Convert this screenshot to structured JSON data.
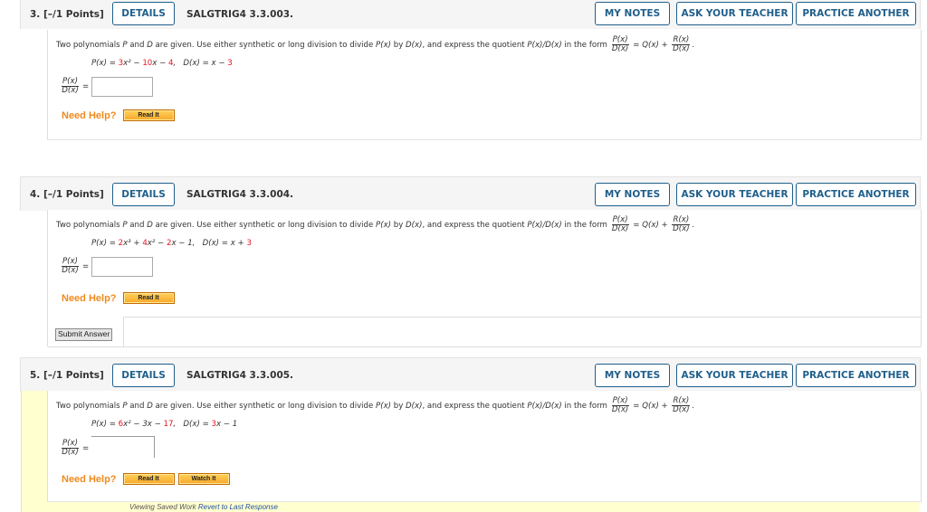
{
  "questions": [
    {
      "number": "3.",
      "points": "[–/1 Points]",
      "details_label": "DETAILS",
      "code": "SALGTRIG4 3.3.003.",
      "my_notes_label": "MY NOTES",
      "ask_teacher_label": "ASK YOUR TEACHER",
      "practice_label": "PRACTICE ANOTHER",
      "prompt_a": "Two polynomials ",
      "prompt_p": "P",
      "prompt_and": " and ",
      "prompt_d": "D",
      "prompt_b": " are given. Use either synthetic or long division to divide ",
      "px": "P(x)",
      "by": " by ",
      "dx": "D(x)",
      "prompt_c": ", and express the quotient ",
      "quot": "P(x)/D(x)",
      "prompt_form": " in the form ",
      "eq_q": " = Q(x) + ",
      "rx": "R(x)",
      "period": ".",
      "given": {
        "p_lhs": "P(x)",
        "p_eq": " = ",
        "p_terms": [
          {
            "text": "3",
            "red": true
          },
          {
            "text": "x² − ",
            "red": false
          },
          {
            "text": "10",
            "red": true
          },
          {
            "text": "x − ",
            "red": false
          },
          {
            "text": "4",
            "red": true
          },
          {
            "text": ",",
            "red": false
          }
        ],
        "d_lhs": "D(x)",
        "d_terms": [
          {
            "text": "x − ",
            "red": false
          },
          {
            "text": "3",
            "red": true
          }
        ]
      },
      "answer_value": "",
      "need_help": "Need Help?",
      "help_buttons": [
        "Read It"
      ]
    },
    {
      "number": "4.",
      "points": "[–/1 Points]",
      "details_label": "DETAILS",
      "code": "SALGTRIG4 3.3.004.",
      "my_notes_label": "MY NOTES",
      "ask_teacher_label": "ASK YOUR TEACHER",
      "practice_label": "PRACTICE ANOTHER",
      "given": {
        "p_lhs": "P(x)",
        "p_terms": [
          {
            "text": "2",
            "red": true
          },
          {
            "text": "x³ + ",
            "red": false
          },
          {
            "text": "4",
            "red": true
          },
          {
            "text": "x² − ",
            "red": false
          },
          {
            "text": "2",
            "red": true
          },
          {
            "text": "x − 1,",
            "red": false
          }
        ],
        "d_lhs": "D(x)",
        "d_terms": [
          {
            "text": "x + ",
            "red": false
          },
          {
            "text": "3",
            "red": true
          }
        ]
      },
      "answer_value": "",
      "need_help": "Need Help?",
      "help_buttons": [
        "Read It"
      ],
      "submit_label": "Submit Answer"
    },
    {
      "number": "5.",
      "points": "[–/1 Points]",
      "details_label": "DETAILS",
      "code": "SALGTRIG4 3.3.005.",
      "my_notes_label": "MY NOTES",
      "ask_teacher_label": "ASK YOUR TEACHER",
      "practice_label": "PRACTICE ANOTHER",
      "given": {
        "p_lhs": "P(x)",
        "p_terms": [
          {
            "text": "6",
            "red": true
          },
          {
            "text": "x² − 3x − ",
            "red": false
          },
          {
            "text": "17",
            "red": true
          },
          {
            "text": ",",
            "red": false
          }
        ],
        "d_lhs": "D(x)",
        "d_terms": [
          {
            "text": "3",
            "red": true
          },
          {
            "text": "x − 1",
            "red": false
          }
        ]
      },
      "answer_value": "",
      "need_help": "Need Help?",
      "help_buttons": [
        "Read It",
        "Watch It"
      ],
      "saved_text": "Viewing Saved Work ",
      "revert_link": "Revert to Last Response"
    }
  ],
  "colors": {
    "button_blue": "#1f5f8b",
    "need_help_orange": "#f08a1c",
    "coefficient_red": "#e8141c",
    "saved_yellow": "#ffffd0"
  }
}
